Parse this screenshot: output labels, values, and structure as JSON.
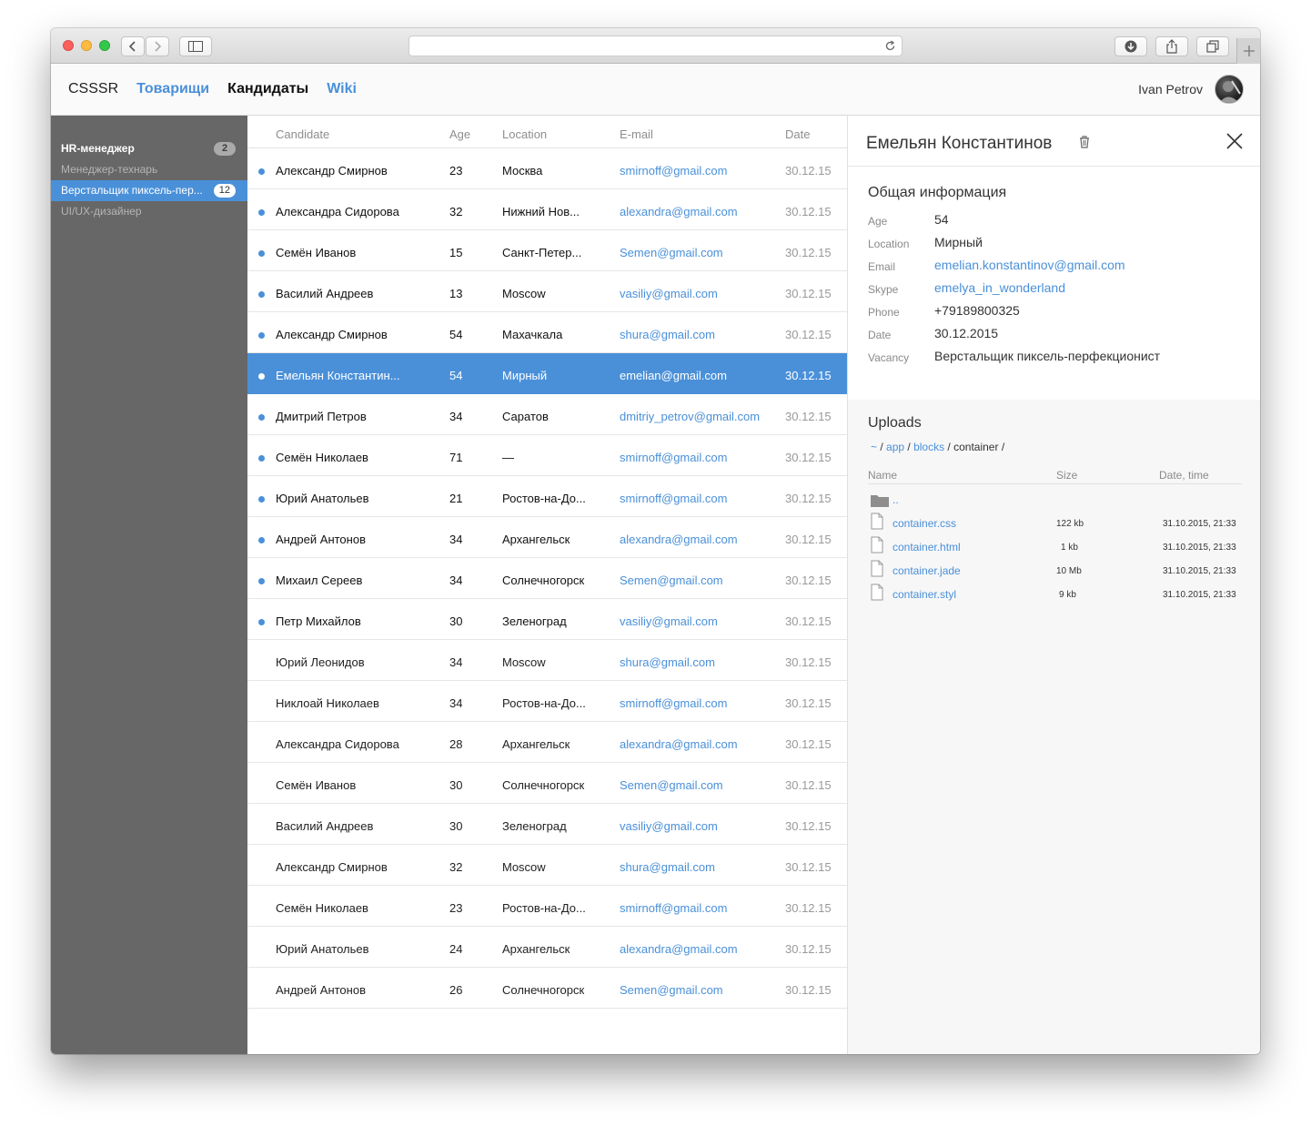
{
  "nav": {
    "brand": "CSSSR",
    "items": [
      "Товарищи",
      "Кандидаты",
      "Wiki"
    ],
    "user_name": "Ivan Petrov"
  },
  "sidebar": {
    "items": [
      {
        "label": "HR-менеджер",
        "badge": "2"
      },
      {
        "label": "Менеджер-технарь",
        "badge": ""
      },
      {
        "label": "Верстальщик пиксель-пер...",
        "badge": "12"
      },
      {
        "label": "UI/UX-дизайнер",
        "badge": ""
      }
    ]
  },
  "table": {
    "columns": [
      "Candidate",
      "Age",
      "Location",
      "E-mail",
      "Date"
    ],
    "rows": [
      {
        "name": "Александр Смирнов",
        "age": "23",
        "location": "Москва",
        "email": "smirnoff@gmail.com",
        "date": "30.12.15"
      },
      {
        "name": "Александра Сидорова",
        "age": "32",
        "location": "Нижний Нов...",
        "email": "alexandra@gmail.com",
        "date": "30.12.15"
      },
      {
        "name": "Семён Иванов",
        "age": "15",
        "location": "Санкт-Петер...",
        "email": "Semen@gmail.com",
        "date": "30.12.15"
      },
      {
        "name": "Василий Андреев",
        "age": "13",
        "location": "Moscow",
        "email": "vasiliy@gmail.com",
        "date": "30.12.15"
      },
      {
        "name": "Александр Смирнов",
        "age": "54",
        "location": "Махачкала",
        "email": "shura@gmail.com",
        "date": "30.12.15"
      },
      {
        "name": "Емельян Константин...",
        "age": "54",
        "location": "Мирный",
        "email": "emelian@gmail.com",
        "date": "30.12.15"
      },
      {
        "name": "Дмитрий Петров",
        "age": "34",
        "location": "Саратов",
        "email": "dmitriy_petrov@gmail.com",
        "date": "30.12.15"
      },
      {
        "name": "Семён Николаев",
        "age": "71",
        "location": "—",
        "email": "smirnoff@gmail.com",
        "date": "30.12.15"
      },
      {
        "name": "Юрий Анатольев",
        "age": "21",
        "location": "Ростов-на-До...",
        "email": "smirnoff@gmail.com",
        "date": "30.12.15"
      },
      {
        "name": "Андрей Антонов",
        "age": "34",
        "location": "Архангельск",
        "email": "alexandra@gmail.com",
        "date": "30.12.15"
      },
      {
        "name": "Михаил Сереев",
        "age": "34",
        "location": "Солнечногорск",
        "email": "Semen@gmail.com",
        "date": "30.12.15"
      },
      {
        "name": "Петр Михайлов",
        "age": "30",
        "location": "Зеленоград",
        "email": "vasiliy@gmail.com",
        "date": "30.12.15"
      },
      {
        "name": "Юрий Леонидов",
        "age": "34",
        "location": "Moscow",
        "email": "shura@gmail.com",
        "date": "30.12.15"
      },
      {
        "name": "Никлоай Николаев",
        "age": "34",
        "location": "Ростов-на-До...",
        "email": "smirnoff@gmail.com",
        "date": "30.12.15"
      },
      {
        "name": "Александра Сидорова",
        "age": "28",
        "location": "Архангельск",
        "email": "alexandra@gmail.com",
        "date": "30.12.15"
      },
      {
        "name": "Семён Иванов",
        "age": "30",
        "location": "Солнечногорск",
        "email": "Semen@gmail.com",
        "date": "30.12.15"
      },
      {
        "name": "Василий Андреев",
        "age": "30",
        "location": "Зеленоград",
        "email": "vasiliy@gmail.com",
        "date": "30.12.15"
      },
      {
        "name": "Александр Смирнов",
        "age": "32",
        "location": "Moscow",
        "email": "shura@gmail.com",
        "date": "30.12.15"
      },
      {
        "name": "Семён Николаев",
        "age": "23",
        "location": "Ростов-на-До...",
        "email": "smirnoff@gmail.com",
        "date": "30.12.15"
      },
      {
        "name": "Юрий Анатольев",
        "age": "24",
        "location": "Архангельск",
        "email": "alexandra@gmail.com",
        "date": "30.12.15"
      },
      {
        "name": "Андрей Антонов",
        "age": "26",
        "location": "Солнечногорск",
        "email": "Semen@gmail.com",
        "date": "30.12.15"
      }
    ]
  },
  "details": {
    "name": "Емельян Константинов",
    "section_title": "Общая информация",
    "fields": [
      {
        "label": "Age",
        "value": "54"
      },
      {
        "label": "Location",
        "value": "Мирный"
      },
      {
        "label": "Email",
        "value": "emelian.konstantinov@gmail.com"
      },
      {
        "label": "Skype",
        "value": "emelya_in_wonderland"
      },
      {
        "label": "Phone",
        "value": "+79189800325"
      },
      {
        "label": "Date",
        "value": "30.12.2015"
      },
      {
        "label": "Vacancy",
        "value": "Верстальщик пиксель-перфекционист"
      }
    ],
    "uploads": {
      "title": "Uploads",
      "path": [
        "~",
        "app",
        "blocks",
        "container"
      ],
      "columns": [
        "Name",
        "Size",
        "Date, time"
      ],
      "parent": "..",
      "files": [
        {
          "name": "container.css",
          "size": "122 kb",
          "datetime": "31.10.2015, 21:33"
        },
        {
          "name": "container.html",
          "size": "1 kb",
          "datetime": "31.10.2015, 21:33"
        },
        {
          "name": "container.jade",
          "size": "10 Mb",
          "datetime": "31.10.2015, 21:33"
        },
        {
          "name": "container.styl",
          "size": "9 kb",
          "datetime": "31.10.2015, 21:33"
        }
      ]
    }
  },
  "colors": {
    "accent": "#4a90d9",
    "sidebar_bg": "#676767"
  }
}
